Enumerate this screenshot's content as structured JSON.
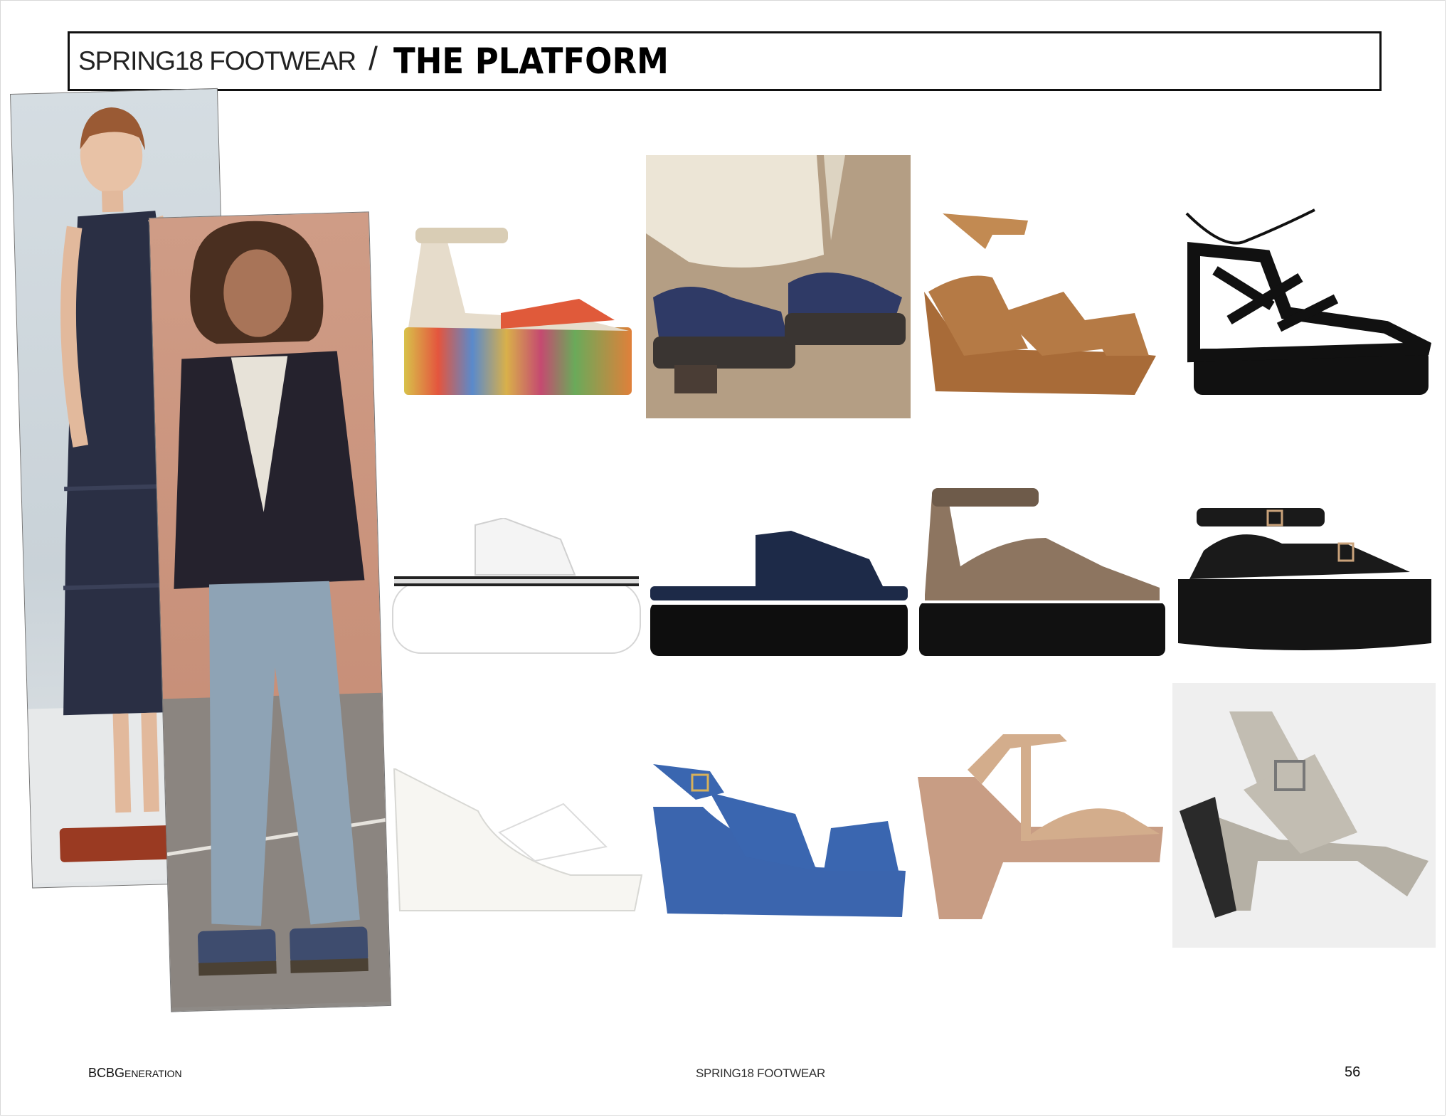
{
  "header": {
    "subtitle": "SPRING18 FOOTWEAR",
    "separator": "/",
    "title": "THE PLATFORM"
  },
  "footer": {
    "brand_main": "BCBG",
    "brand_small": "ENERATION",
    "center": "SPRING18 FOOTWEAR",
    "page_number": "56"
  },
  "collage": [
    {
      "name": "model-photo-pleated-dress",
      "colors": {
        "dress": "#2a2f44",
        "shoe": "#9a3a22"
      }
    },
    {
      "name": "model-photo-flared-jeans",
      "colors": {
        "jeans": "#8ea3b5",
        "top": "#25222d",
        "shoe": "#3e4c6e"
      }
    }
  ],
  "shoes": [
    {
      "name": "striped-espadrille-flatform",
      "colors": {
        "upper": "#e6dccb",
        "accent": "#e05a3a",
        "sole": "#d9b04a"
      }
    },
    {
      "name": "laced-denim-espadrille-photo",
      "colors": {
        "upper": "#2f3a66",
        "sole": "#3a3532"
      }
    },
    {
      "name": "tan-suede-wrap-wedge",
      "colors": {
        "upper": "#b57a45",
        "sole": "#a86b38"
      }
    },
    {
      "name": "black-lace-up-flatform",
      "colors": {
        "upper": "#111111",
        "sole": "#111111"
      }
    },
    {
      "name": "white-slide-flatform",
      "colors": {
        "upper": "#f4f4f4",
        "sole": "#ffffff",
        "trim": "#222222"
      }
    },
    {
      "name": "navy-slide-flatform",
      "colors": {
        "upper": "#1d2a48",
        "sole": "#0e0e0e",
        "trim": "#ffffff"
      }
    },
    {
      "name": "taupe-ankle-strap-flatform",
      "colors": {
        "upper": "#8d7560",
        "sole": "#111111",
        "strap": "#6e5b4a"
      }
    },
    {
      "name": "black-buckle-flatform",
      "colors": {
        "upper": "#1a1a1a",
        "sole": "#141414",
        "buckle": "#c9a27a"
      }
    },
    {
      "name": "white-patent-wedge",
      "colors": {
        "upper": "#f7f6f2",
        "sole": "#f2f1ec"
      }
    },
    {
      "name": "blue-slingback-wedge",
      "colors": {
        "upper": "#3a66b0",
        "sole": "#3b65ae",
        "buckle": "#d8b15a"
      }
    },
    {
      "name": "nude-t-strap-platform",
      "colors": {
        "upper": "#d3ad8c",
        "sole": "#c89d84"
      }
    },
    {
      "name": "grey-suede-block-platform",
      "colors": {
        "upper": "#c2bdb2",
        "sole": "#b5b0a5",
        "heel": "#2a2a2a"
      }
    }
  ]
}
